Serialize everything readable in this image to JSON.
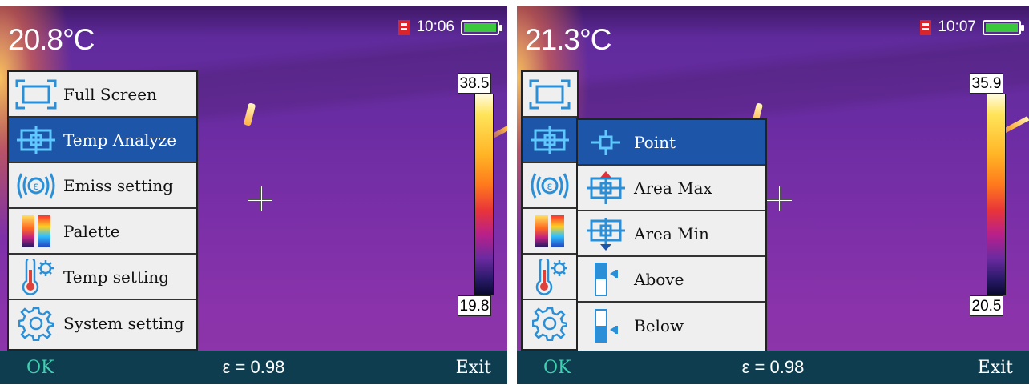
{
  "left_screen": {
    "temperature": "20.8°C",
    "time": "10:06",
    "colorbar_max": "38.5",
    "colorbar_min": "19.8",
    "menu": [
      {
        "icon": "full-screen-icon",
        "label": "Full Screen",
        "selected": false
      },
      {
        "icon": "temp-analyze-icon",
        "label": "Temp Analyze",
        "selected": true
      },
      {
        "icon": "emissivity-icon",
        "label": "Emiss setting",
        "selected": false
      },
      {
        "icon": "palette-icon",
        "label": "Palette",
        "selected": false
      },
      {
        "icon": "thermometer-gear-icon",
        "label": "Temp setting",
        "selected": false
      },
      {
        "icon": "gear-icon",
        "label": "System setting",
        "selected": false
      }
    ],
    "bottom": {
      "ok": "OK",
      "emissivity": "ε = 0.98",
      "exit": "Exit"
    }
  },
  "right_screen": {
    "temperature": "21.3°C",
    "time": "10:07",
    "colorbar_max": "35.9",
    "colorbar_min": "20.5",
    "submenu": [
      {
        "icon": "point-icon",
        "label": "Point",
        "selected": true
      },
      {
        "icon": "area-max-icon",
        "label": "Area Max",
        "selected": false
      },
      {
        "icon": "area-min-icon",
        "label": "Area Min",
        "selected": false
      },
      {
        "icon": "above-icon",
        "label": "Above",
        "selected": false
      },
      {
        "icon": "below-icon",
        "label": "Below",
        "selected": false
      }
    ],
    "bottom": {
      "ok": "OK",
      "emissivity": "ε = 0.98",
      "exit": "Exit"
    }
  },
  "colors": {
    "selected_bg": "#1d55a8",
    "menu_bg": "#efefef",
    "bottom_bar": "#0e3d50",
    "ok_text": "#3fd0b0",
    "battery": "#3cc83c",
    "sd_card": "#d9252a"
  }
}
